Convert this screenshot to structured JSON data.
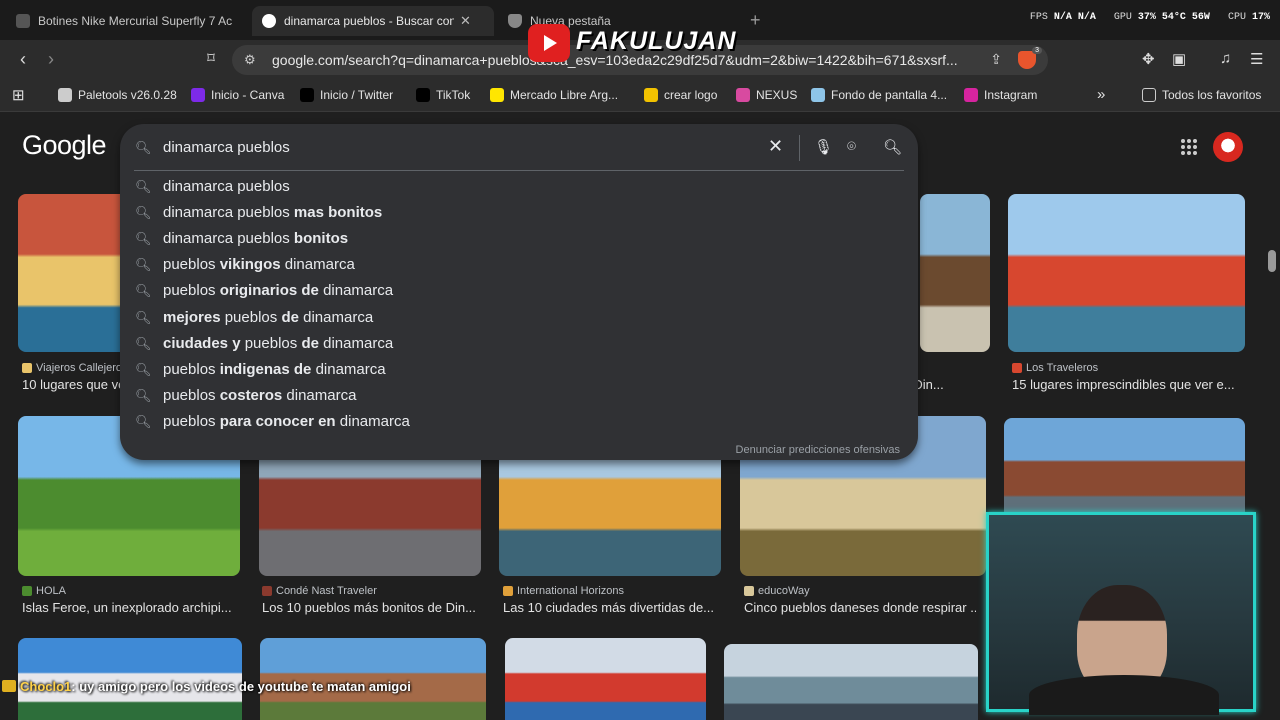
{
  "tabs": [
    {
      "title": "Botines Nike Mercurial Superfly 7 Ac",
      "active": false,
      "favicon_color": "#555555"
    },
    {
      "title": "dinamarca pueblos - Buscar con Google",
      "active": true,
      "favicon_color": "#ffffff"
    },
    {
      "title": "Nueva pestaña",
      "active": false,
      "favicon_color": "#888888"
    }
  ],
  "stats": {
    "fps_label": "FPS",
    "fps_value": "N/A N/A",
    "gpu_label": "GPU",
    "gpu_value": "37% 54°C 56W",
    "cpu_label": "CPU",
    "cpu_value": "17%"
  },
  "address": {
    "url": "google.com/search?q=dinamarca+pueblos&sca_esv=103eda2c29df25d7&udm=2&biw=1422&bih=671&sxsrf..."
  },
  "bookmarks": [
    {
      "label": "Paletools v26.0.28",
      "icon_color": "#cccccc"
    },
    {
      "label": "Inicio - Canva",
      "icon_color": "#7d2ae8"
    },
    {
      "label": "Inicio / Twitter",
      "icon_color": "#000000"
    },
    {
      "label": "TikTok",
      "icon_color": "#000000"
    },
    {
      "label": "Mercado Libre Arg...",
      "icon_color": "#ffe600"
    },
    {
      "label": "crear logo",
      "icon_color": "#f2c200"
    },
    {
      "label": "NEXUS",
      "icon_color": "#d84aa0"
    },
    {
      "label": "Fondo de pantalla 4...",
      "icon_color": "#8ec5e8"
    },
    {
      "label": "Instagram",
      "icon_color": "#d6249f"
    }
  ],
  "bookmarks_more": "»",
  "bookmarks_all": "Todos los favoritos",
  "google": {
    "logo": "Google"
  },
  "search": {
    "query": "dinamarca pueblos",
    "suggestions": [
      [
        {
          "t": "dinamarca pueblos",
          "b": false
        }
      ],
      [
        {
          "t": "dinamarca pueblos ",
          "b": false
        },
        {
          "t": "mas bonitos",
          "b": true
        }
      ],
      [
        {
          "t": "dinamarca pueblos ",
          "b": false
        },
        {
          "t": "bonitos",
          "b": true
        }
      ],
      [
        {
          "t": "pueblos ",
          "b": false
        },
        {
          "t": "vikingos",
          "b": true
        },
        {
          "t": " dinamarca",
          "b": false
        }
      ],
      [
        {
          "t": "pueblos ",
          "b": false
        },
        {
          "t": "originarios de",
          "b": true
        },
        {
          "t": " dinamarca",
          "b": false
        }
      ],
      [
        {
          "t": "mejores",
          "b": true
        },
        {
          "t": " pueblos ",
          "b": false
        },
        {
          "t": "de",
          "b": true
        },
        {
          "t": " dinamarca",
          "b": false
        }
      ],
      [
        {
          "t": "ciudades y",
          "b": true
        },
        {
          "t": " pueblos ",
          "b": false
        },
        {
          "t": "de",
          "b": true
        },
        {
          "t": " dinamarca",
          "b": false
        }
      ],
      [
        {
          "t": "pueblos ",
          "b": false
        },
        {
          "t": "indigenas de",
          "b": true
        },
        {
          "t": " dinamarca",
          "b": false
        }
      ],
      [
        {
          "t": "pueblos ",
          "b": false
        },
        {
          "t": "costeros",
          "b": true
        },
        {
          "t": " dinamarca",
          "b": false
        }
      ],
      [
        {
          "t": "pueblos ",
          "b": false
        },
        {
          "t": "para conocer en",
          "b": true
        },
        {
          "t": " dinamarca",
          "b": false
        }
      ]
    ],
    "report": "Denunciar predicciones ofensivas"
  },
  "results": [
    {
      "source": "Viajeros Callejeros",
      "caption": "10 lugares que ve...",
      "colors": [
        "#c8553d",
        "#e9c46a",
        "#2a6f97"
      ]
    },
    {
      "source": "",
      "caption": "...to en Din...",
      "colors": [
        "#8ab6d6",
        "#6b4a2f",
        "#c9c2b0"
      ]
    },
    {
      "source": "Los Traveleros",
      "caption": "15 lugares imprescindibles que ver e...",
      "colors": [
        "#9ec9ec",
        "#d7472f",
        "#3f7e9c"
      ]
    },
    {
      "source": "HOLA",
      "caption": "Islas Feroe, un inexplorado archipi...",
      "colors": [
        "#77b7e8",
        "#4c8c2f",
        "#6fae3c"
      ]
    },
    {
      "source": "Condé Nast Traveler",
      "caption": "Los 10 pueblos más bonitos de Din...",
      "colors": [
        "#8fa6b8",
        "#8b3a2e",
        "#6e6e72"
      ]
    },
    {
      "source": "International Horizons",
      "caption": "Las 10 ciudades más divertidas de...",
      "colors": [
        "#a9c8e0",
        "#e0a03a",
        "#3d6577"
      ]
    },
    {
      "source": "educoWay",
      "caption": "Cinco pueblos daneses donde respirar ...",
      "colors": [
        "#7fa7cf",
        "#d8c79a",
        "#7a6a3a"
      ]
    },
    {
      "source": "",
      "caption": "",
      "colors": [
        "#6ea6d8",
        "#8a4a32",
        "#5f6f7a"
      ]
    },
    {
      "source": "",
      "caption": "",
      "colors": [
        "#3f8ad6",
        "#e6e6ea",
        "#2d6e3a"
      ]
    },
    {
      "source": "",
      "caption": "",
      "colors": [
        "#5f9fd8",
        "#a46a48",
        "#5c7a3a"
      ]
    },
    {
      "source": "",
      "caption": "",
      "colors": [
        "#d2dbe6",
        "#d23a2e",
        "#2f6ab0"
      ]
    },
    {
      "source": "",
      "caption": "",
      "colors": [
        "#c6d3de",
        "#6f8c9a",
        "#3a4652"
      ]
    }
  ],
  "overlay": {
    "channel": "FAKULUJAN",
    "chat_user": "Choclo1",
    "chat_message": ": uy amigo pero los videos de youtube te matan amigoi"
  }
}
